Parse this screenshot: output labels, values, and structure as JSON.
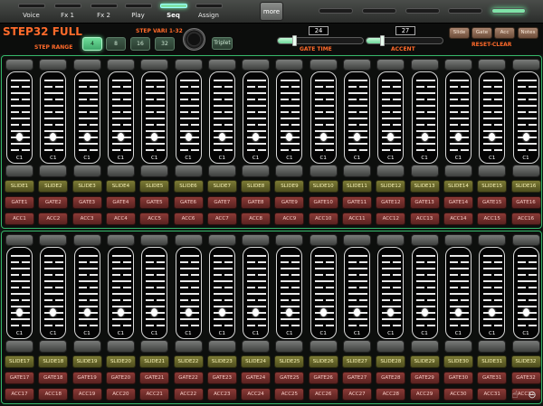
{
  "tabs": [
    {
      "label": "Voice",
      "active": false
    },
    {
      "label": "Fx 1",
      "active": false
    },
    {
      "label": "Fx 2",
      "active": false
    },
    {
      "label": "Play",
      "active": false
    },
    {
      "label": "Seq",
      "active": true
    },
    {
      "label": "Assign",
      "active": false
    }
  ],
  "more_label": "more",
  "right_tabs": [
    {
      "active": false
    },
    {
      "active": false
    },
    {
      "active": false
    },
    {
      "active": false
    },
    {
      "active": false
    },
    {
      "active": true
    }
  ],
  "header": {
    "title": "STEP32 FULL",
    "step_range_label": "STEP RANGE",
    "step_vari_label": "STEP VARI 1-32",
    "range_buttons": [
      {
        "label": "4",
        "active": true
      },
      {
        "label": "8",
        "active": false
      },
      {
        "label": "16",
        "active": false
      },
      {
        "label": "32",
        "active": false
      }
    ],
    "triplet_label": "Triplet",
    "gate_time_label": "GATE TIME",
    "gate_time_value": "24",
    "gate_time_fraction": 0.2,
    "accent_label": "ACCENT",
    "accent_value": "27",
    "accent_fraction": 0.22,
    "mode_buttons": [
      "Slide",
      "Gate",
      "Acc",
      "Notes"
    ],
    "reset_clear_label": "RESET-CLEAR"
  },
  "rows": [
    {
      "steps": [
        {
          "note": "C1",
          "slide": "SLIDE1",
          "gate": "GATE1",
          "acc": "ACC1"
        },
        {
          "note": "C1",
          "slide": "SLIDE2",
          "gate": "GATE2",
          "acc": "ACC2"
        },
        {
          "note": "C1",
          "slide": "SLIDE3",
          "gate": "GATE3",
          "acc": "ACC3"
        },
        {
          "note": "C1",
          "slide": "SLIDE4",
          "gate": "GATE4",
          "acc": "ACC4"
        },
        {
          "note": "C1",
          "slide": "SLIDE5",
          "gate": "GATE5",
          "acc": "ACC5"
        },
        {
          "note": "C1",
          "slide": "SLIDE6",
          "gate": "GATE6",
          "acc": "ACC6"
        },
        {
          "note": "C1",
          "slide": "SLIDE7",
          "gate": "GATE7",
          "acc": "ACC7"
        },
        {
          "note": "C1",
          "slide": "SLIDE8",
          "gate": "GATE8",
          "acc": "ACC8"
        },
        {
          "note": "C1",
          "slide": "SLIDE9",
          "gate": "GATE9",
          "acc": "ACC9"
        },
        {
          "note": "C1",
          "slide": "SLIDE10",
          "gate": "GATE10",
          "acc": "ACC10"
        },
        {
          "note": "C1",
          "slide": "SLIDE11",
          "gate": "GATE11",
          "acc": "ACC11"
        },
        {
          "note": "C1",
          "slide": "SLIDE12",
          "gate": "GATE12",
          "acc": "ACC12"
        },
        {
          "note": "C1",
          "slide": "SLIDE13",
          "gate": "GATE13",
          "acc": "ACC13"
        },
        {
          "note": "C1",
          "slide": "SLIDE14",
          "gate": "GATE14",
          "acc": "ACC14"
        },
        {
          "note": "C1",
          "slide": "SLIDE15",
          "gate": "GATE15",
          "acc": "ACC15"
        },
        {
          "note": "C1",
          "slide": "SLIDE16",
          "gate": "GATE16",
          "acc": "ACC16"
        }
      ]
    },
    {
      "steps": [
        {
          "note": "C1",
          "slide": "SLIDE17",
          "gate": "GATE17",
          "acc": "ACC17"
        },
        {
          "note": "C1",
          "slide": "SLIDE18",
          "gate": "GATE18",
          "acc": "ACC18"
        },
        {
          "note": "C1",
          "slide": "SLIDE19",
          "gate": "GATE19",
          "acc": "ACC19"
        },
        {
          "note": "C1",
          "slide": "SLIDE20",
          "gate": "GATE20",
          "acc": "ACC20"
        },
        {
          "note": "C1",
          "slide": "SLIDE21",
          "gate": "GATE21",
          "acc": "ACC21"
        },
        {
          "note": "C1",
          "slide": "SLIDE22",
          "gate": "GATE22",
          "acc": "ACC22"
        },
        {
          "note": "C1",
          "slide": "SLIDE23",
          "gate": "GATE23",
          "acc": "ACC23"
        },
        {
          "note": "C1",
          "slide": "SLIDE24",
          "gate": "GATE24",
          "acc": "ACC24"
        },
        {
          "note": "C1",
          "slide": "SLIDE25",
          "gate": "GATE25",
          "acc": "ACC25"
        },
        {
          "note": "C1",
          "slide": "SLIDE26",
          "gate": "GATE26",
          "acc": "ACC26"
        },
        {
          "note": "C1",
          "slide": "SLIDE27",
          "gate": "GATE27",
          "acc": "ACC27"
        },
        {
          "note": "C1",
          "slide": "SLIDE28",
          "gate": "GATE28",
          "acc": "ACC28"
        },
        {
          "note": "C1",
          "slide": "SLIDE29",
          "gate": "GATE29",
          "acc": "ACC29"
        },
        {
          "note": "C1",
          "slide": "SLIDE30",
          "gate": "GATE30",
          "acc": "ACC30"
        },
        {
          "note": "C1",
          "slide": "SLIDE31",
          "gate": "GATE31",
          "acc": "ACC31"
        },
        {
          "note": "C1",
          "slide": "SLIDE32",
          "gate": "GATE32",
          "acc": "ACC32"
        }
      ]
    }
  ],
  "corner_icons": [
    "hand-pointer-icon",
    "zoom-out-icon"
  ],
  "colors": {
    "accent_green": "#35b86a",
    "title_orange": "#ff6a2a",
    "slide_olive": "#6b6a2e",
    "gate_red": "#7a2e2a"
  }
}
